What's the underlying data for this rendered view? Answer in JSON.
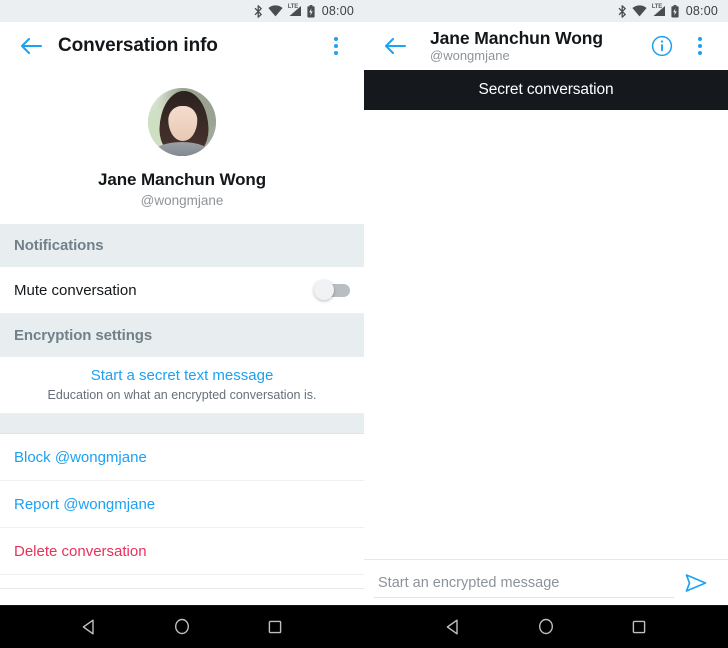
{
  "status_bar": {
    "time": "08:00",
    "icons": [
      "bluetooth-icon",
      "wifi-icon",
      "lte-signal-icon",
      "battery-icon"
    ],
    "network_label": "LTE"
  },
  "colors": {
    "accent": "#1da1f2",
    "danger": "#e8325a",
    "section_header_bg": "#e8eef0",
    "section_header_text": "#72808a",
    "banner_bg": "#15191d",
    "status_bar_bg": "#eceff1",
    "nav_bar_bg": "#000000"
  },
  "left_panel": {
    "app_bar": {
      "back_label": "Back",
      "title": "Conversation info",
      "overflow_label": "More options"
    },
    "profile": {
      "name": "Jane Manchun Wong",
      "handle": "@wongmjane",
      "avatar_alt": "Jane Manchun Wong profile photo"
    },
    "sections": [
      {
        "header": "Notifications",
        "rows": [
          {
            "label": "Mute conversation",
            "type": "toggle",
            "value": "off"
          }
        ]
      },
      {
        "header": "Encryption settings",
        "rows": [
          {
            "label": "Start a secret text message",
            "sublabel": "Education on what an encrypted conversation is.",
            "type": "link"
          }
        ]
      }
    ],
    "actions": [
      {
        "label": "Block @wongmjane",
        "type": "link"
      },
      {
        "label": "Report @wongmjane",
        "type": "link"
      },
      {
        "label": "Delete conversation",
        "type": "danger"
      }
    ]
  },
  "right_panel": {
    "app_bar": {
      "back_label": "Back",
      "title": "Jane Manchun Wong",
      "handle": "@wongmjane",
      "info_label": "Conversation info",
      "overflow_label": "More options"
    },
    "banner": "Secret conversation",
    "composer": {
      "placeholder": "Start an encrypted message",
      "value": "",
      "send_label": "Send"
    }
  },
  "nav_bar": {
    "buttons": [
      "back-nav-icon",
      "home-nav-icon",
      "recents-nav-icon"
    ]
  }
}
